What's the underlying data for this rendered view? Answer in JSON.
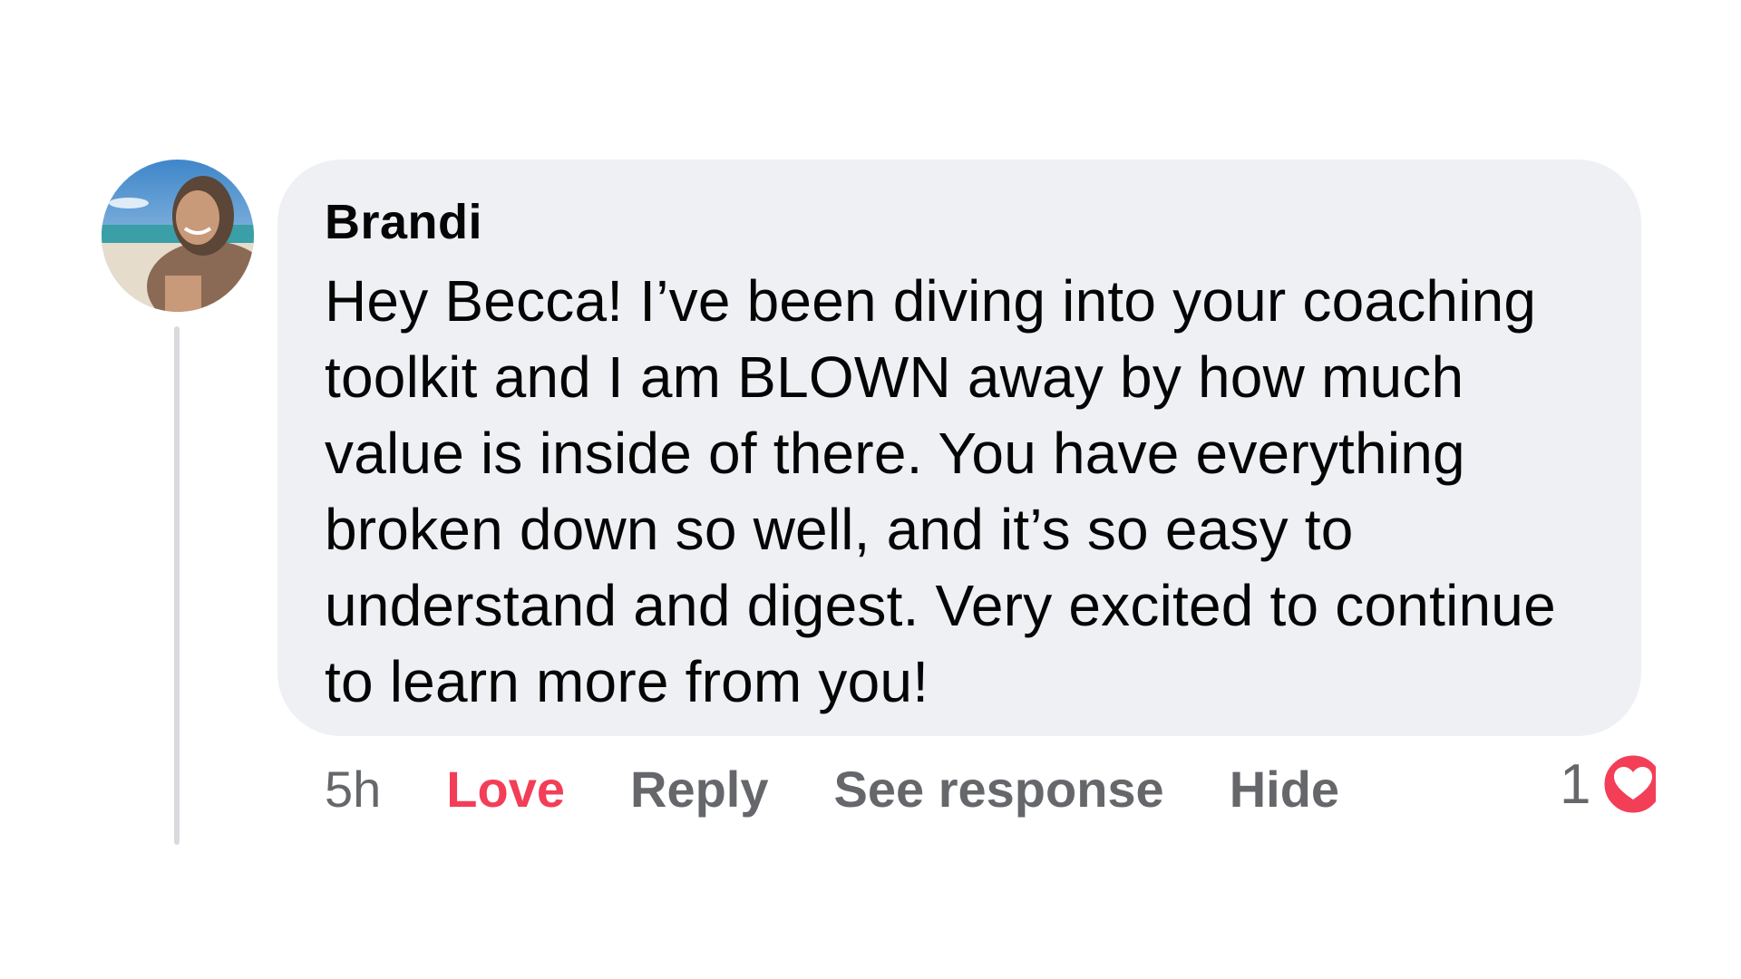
{
  "comment": {
    "author": "Brandi",
    "text": "Hey Becca! I’ve been diving into your coaching toolkit and I am BLOWN away by how much value is inside of there. You have everything broken down so well, and it’s so easy to understand and digest. Very excited to continue to learn more from you!",
    "avatar": "beach-selfie-avatar"
  },
  "actions": {
    "time": "5h",
    "love": "Love",
    "reply": "Reply",
    "see_response": "See response",
    "hide": "Hide"
  },
  "reactions": {
    "count": "1",
    "icon": "heart-icon"
  },
  "colors": {
    "bubble": "#eff0f4",
    "love": "#f33e58",
    "action_text": "#65676b",
    "heart": "#f33e58"
  }
}
